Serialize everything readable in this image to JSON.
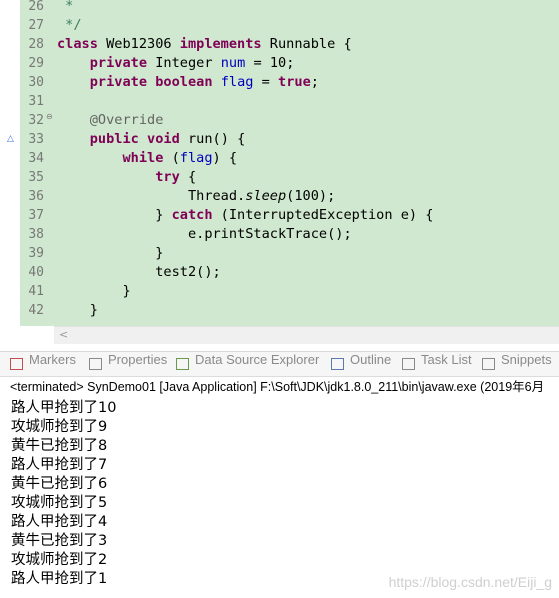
{
  "editor": {
    "lines": [
      {
        "n": "26",
        "html": " *"
      },
      {
        "n": "27",
        "html": " */"
      },
      {
        "n": "28",
        "html": "<span class=\"kw\">class</span> Web12306 <span class=\"kw\">implements</span> Runnable {"
      },
      {
        "n": "29",
        "html": "    <span class=\"kw\">private</span> Integer <span class=\"fld\">num</span> = 10;"
      },
      {
        "n": "30",
        "html": "    <span class=\"kw\">private</span> <span class=\"kw\">boolean</span> <span class=\"fld\">flag</span> = <span class=\"kw\">true</span>;"
      },
      {
        "n": "31",
        "html": ""
      },
      {
        "n": "32",
        "html": "    <span class=\"ann\">@Override</span>",
        "fold": true
      },
      {
        "n": "33",
        "html": "    <span class=\"kw\">public</span> <span class=\"kw\">void</span> run() {",
        "override": true
      },
      {
        "n": "34",
        "html": "        <span class=\"kw\">while</span> (<span class=\"fld\">flag</span>) {"
      },
      {
        "n": "35",
        "html": "            <span class=\"kw\">try</span> {"
      },
      {
        "n": "36",
        "html": "                Thread.<span class=\"st\">sleep</span>(100);"
      },
      {
        "n": "37",
        "html": "            } <span class=\"kw\">catch</span> (InterruptedException e) {"
      },
      {
        "n": "38",
        "html": "                e.printStackTrace();"
      },
      {
        "n": "39",
        "html": "            }"
      },
      {
        "n": "40",
        "html": "            test2();"
      },
      {
        "n": "41",
        "html": "        }"
      },
      {
        "n": "42",
        "html": "    }"
      }
    ]
  },
  "tabs": [
    {
      "label": "Markers",
      "icon": "markers-icon",
      "color": "#c05050"
    },
    {
      "label": "Properties",
      "icon": "properties-icon",
      "color": "#8a8a8a"
    },
    {
      "label": "Data Source Explorer",
      "icon": "data-source-icon",
      "color": "#6a9a4a"
    },
    {
      "label": "Outline",
      "icon": "outline-icon",
      "color": "#5a7ab0"
    },
    {
      "label": "Task List",
      "icon": "task-list-icon",
      "color": "#8a8a8a"
    },
    {
      "label": "Snippets",
      "icon": "snippets-icon",
      "color": "#8a8a8a"
    }
  ],
  "console": {
    "status": "<terminated> SynDemo01 [Java Application] F:\\Soft\\JDK\\jdk1.8.0_211\\bin\\javaw.exe (2019年6月",
    "output": [
      "路人甲抢到了10",
      "攻城师抢到了9",
      "黄牛已抢到了8",
      "路人甲抢到了7",
      "黄牛已抢到了6",
      "攻城师抢到了5",
      "路人甲抢到了4",
      "黄牛已抢到了3",
      "攻城师抢到了2",
      "路人甲抢到了1"
    ]
  },
  "watermark": "https://blog.csdn.net/Eiji_g"
}
